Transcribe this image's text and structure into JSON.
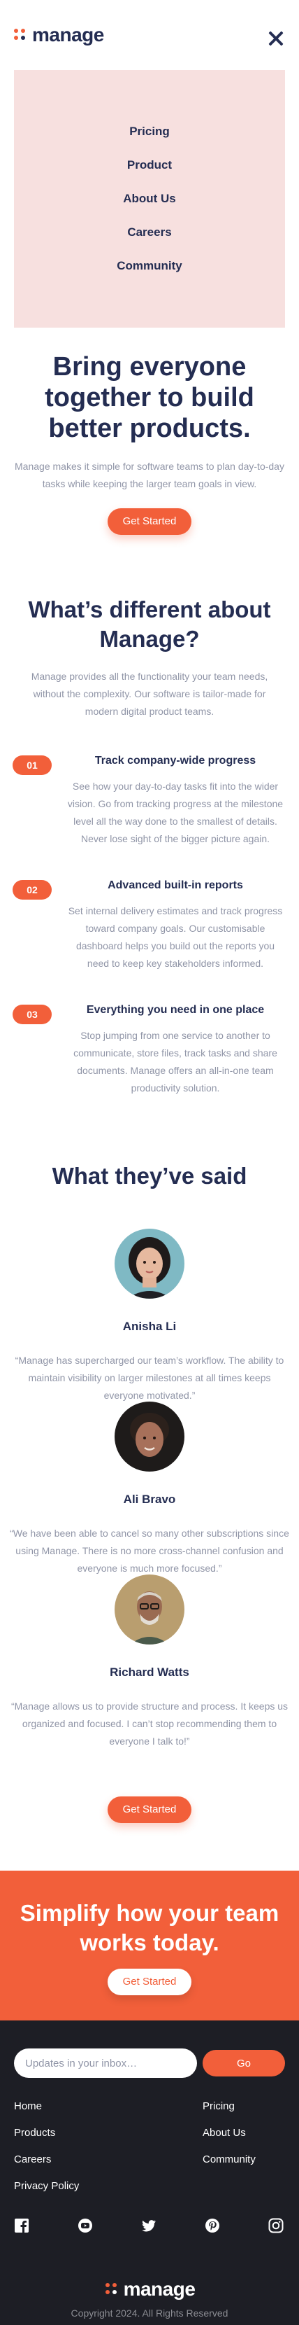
{
  "brand": {
    "name": "manage",
    "accent": "#f25f3a",
    "navy": "#242d52"
  },
  "nav": {
    "items": [
      "Pricing",
      "Product",
      "About Us",
      "Careers",
      "Community"
    ]
  },
  "hero": {
    "title": "Bring everyone together to build better products.",
    "text": "Manage makes it simple for software teams to plan day-to-day tasks while keeping the larger team goals in view.",
    "cta": "Get Started"
  },
  "different": {
    "title": "What’s different about Manage?",
    "intro": "Manage provides all the functionality your team needs, without the complexity. Our software is tailor-made for modern digital product teams.",
    "features": [
      {
        "num": "01",
        "title": "Track company-wide progress",
        "text": "See how your day-to-day tasks fit into the wider vision. Go from tracking progress at the milestone level all the way done to the smallest of details. Never lose sight of the bigger picture again."
      },
      {
        "num": "02",
        "title": "Advanced built-in reports",
        "text": "Set internal delivery estimates and track progress toward company goals. Our customisable dashboard helps you build out the reports you need to keep key stakeholders informed."
      },
      {
        "num": "03",
        "title": "Everything you need in one place",
        "text": "Stop jumping from one service to another to communicate, store files, track tasks and share documents. Manage offers an all-in-one team productivity solution."
      }
    ]
  },
  "testimonials": {
    "title": "What they’ve said",
    "items": [
      {
        "name": "Anisha Li",
        "quote": "“Manage has supercharged our team’s workflow. The ability to maintain visibility on larger milestones at all times keeps everyone motivated.”"
      },
      {
        "name": "Ali Bravo",
        "quote": "“We have been able to cancel so many other subscriptions since using Manage. There is no more cross-channel confusion and everyone is much more focused.”"
      },
      {
        "name": "Richard Watts",
        "quote": "“Manage allows us to provide structure and process. It keeps us organized and focused. I can’t stop recommending them to everyone I talk to!”"
      }
    ],
    "cta": "Get Started"
  },
  "cta_band": {
    "title": "Simplify how your team works today.",
    "cta": "Get Started"
  },
  "footer": {
    "newsletter_placeholder": "Updates in your inbox…",
    "newsletter_button": "Go",
    "links_left": [
      "Home",
      "Products",
      "Careers",
      "Privacy Policy"
    ],
    "links_right": [
      "Pricing",
      "About Us",
      "Community"
    ],
    "socials": [
      "facebook-icon",
      "youtube-icon",
      "twitter-icon",
      "pinterest-icon",
      "instagram-icon"
    ],
    "copyright": "Copyright 2024. All Rights Reserved"
  }
}
